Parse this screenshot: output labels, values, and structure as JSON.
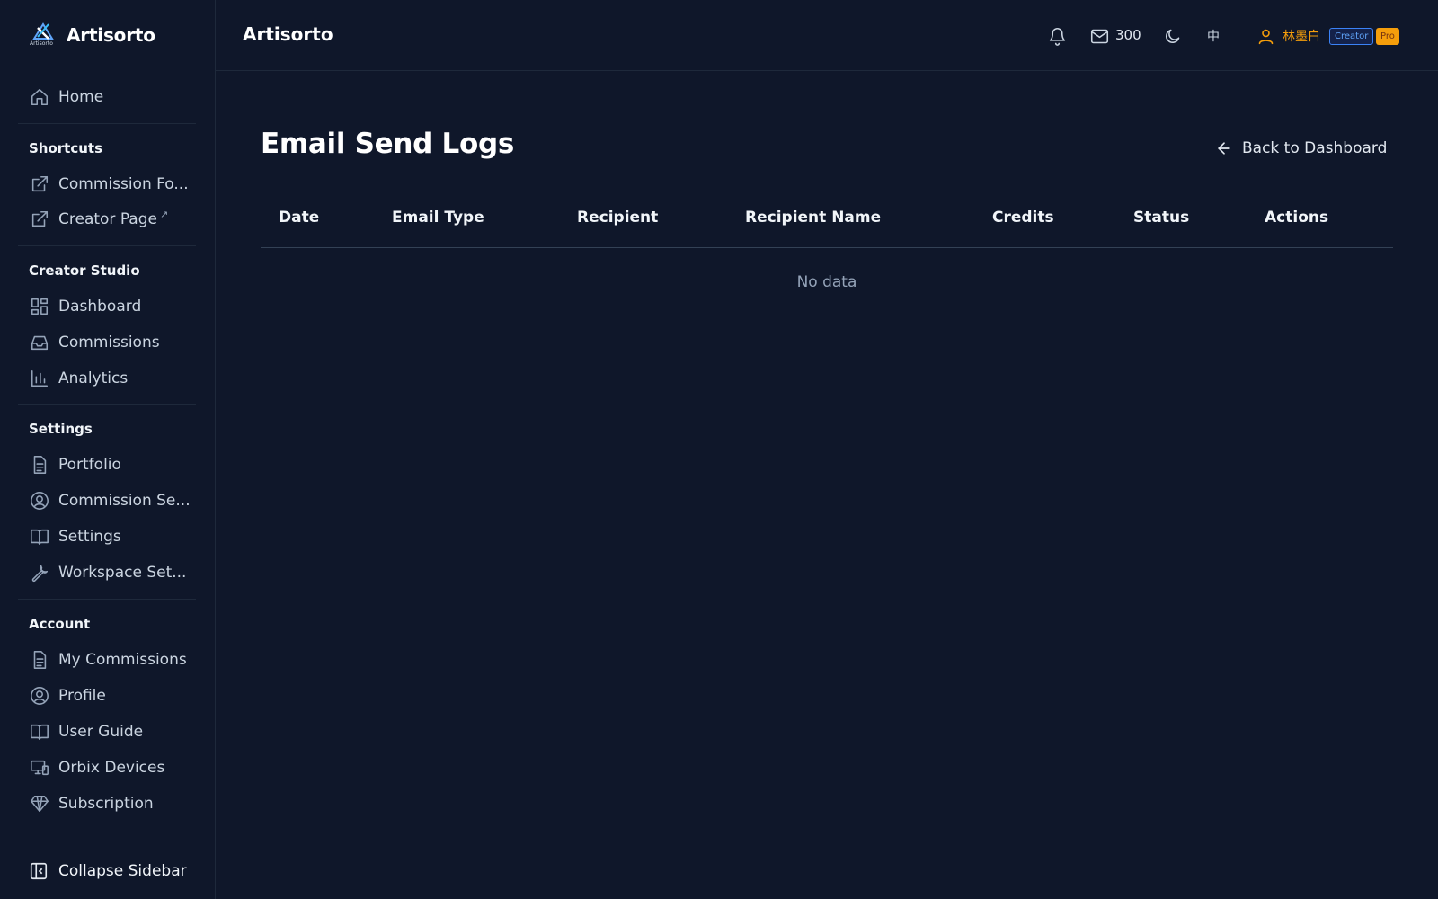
{
  "app": {
    "name": "Artisorto",
    "logo_caption": "Artisorto"
  },
  "sidebar": {
    "home": {
      "label": "Home",
      "icon": "home-icon"
    },
    "sections": [
      {
        "title": "Shortcuts",
        "items": [
          {
            "label": "Commission Fo...",
            "icon": "external-link-icon"
          },
          {
            "label": "Creator Page",
            "icon": "external-link-icon",
            "suffix": "↗"
          }
        ]
      },
      {
        "title": "Creator Studio",
        "items": [
          {
            "label": "Dashboard",
            "icon": "dashboard-icon"
          },
          {
            "label": "Commissions",
            "icon": "inbox-icon"
          },
          {
            "label": "Analytics",
            "icon": "bar-chart-icon"
          }
        ]
      },
      {
        "title": "Settings",
        "items": [
          {
            "label": "Portfolio",
            "icon": "file-icon"
          },
          {
            "label": "Commission Se...",
            "icon": "user-circle-icon"
          },
          {
            "label": "Settings",
            "icon": "book-icon"
          },
          {
            "label": "Workspace Set...",
            "icon": "wrench-icon"
          }
        ]
      },
      {
        "title": "Account",
        "items": [
          {
            "label": "My Commissions",
            "icon": "file-icon"
          },
          {
            "label": "Profile",
            "icon": "user-circle-icon"
          },
          {
            "label": "User Guide",
            "icon": "book-icon"
          },
          {
            "label": "Orbix Devices",
            "icon": "devices-icon"
          },
          {
            "label": "Subscription",
            "icon": "diamond-icon"
          }
        ]
      }
    ],
    "collapse_label": "Collapse Sidebar"
  },
  "topbar": {
    "title": "Artisorto",
    "mail_count": "300",
    "language": "中",
    "user_name": "林墨白",
    "role_badge": "Creator",
    "plan_badge": "Pro"
  },
  "main": {
    "title": "Email Send Logs",
    "back_label": "Back to Dashboard",
    "columns": [
      "Date",
      "Email Type",
      "Recipient",
      "Recipient Name",
      "Credits",
      "Status",
      "Actions"
    ],
    "empty_text": "No data"
  },
  "colors": {
    "background": "#0f172a",
    "accent": "#f59e0b",
    "badge_blue": "#3b82f6"
  }
}
